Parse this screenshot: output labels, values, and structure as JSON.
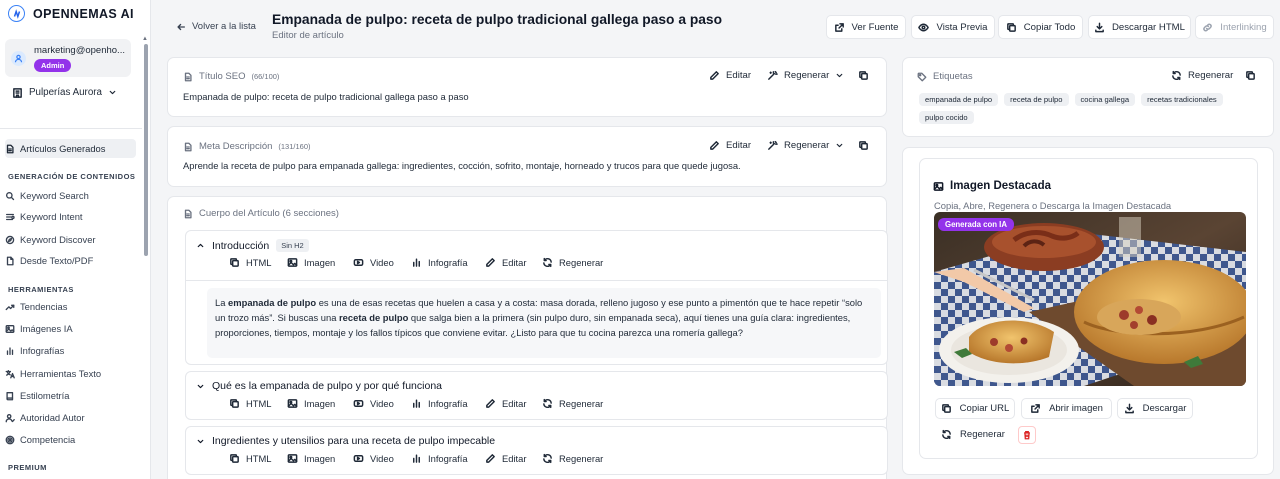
{
  "app": {
    "name": "OPENNEMAS AI"
  },
  "user": {
    "email": "marketing@openho...",
    "role_badge": "Admin"
  },
  "org": {
    "name": "Pulperías Aurora"
  },
  "sidebar": {
    "active_item": {
      "label": "Artículos Generados",
      "icon": "document-icon"
    },
    "groups": [
      {
        "heading": "GENERACIÓN DE CONTENIDOS",
        "items": [
          {
            "label": "Keyword Search",
            "icon": "search-icon"
          },
          {
            "label": "Keyword Intent",
            "icon": "target-icon"
          },
          {
            "label": "Keyword Discover",
            "icon": "compass-icon"
          },
          {
            "label": "Desde Texto/PDF",
            "icon": "file-icon"
          }
        ]
      },
      {
        "heading": "HERRAMIENTAS",
        "items": [
          {
            "label": "Tendencias",
            "icon": "trending-icon"
          },
          {
            "label": "Imágenes IA",
            "icon": "image-icon"
          },
          {
            "label": "Infografías",
            "icon": "bar-chart-icon"
          },
          {
            "label": "Herramientas Texto",
            "icon": "translate-icon"
          },
          {
            "label": "Estilometría",
            "icon": "book-icon"
          },
          {
            "label": "Autoridad Autor",
            "icon": "user-check-icon"
          },
          {
            "label": "Competencia",
            "icon": "radar-icon"
          }
        ]
      },
      {
        "heading": "PREMIUM",
        "items": []
      }
    ]
  },
  "header": {
    "back_label": "Volver a la lista",
    "title": "Empanada de pulpo: receta de pulpo tradicional gallega paso a paso",
    "subtitle": "Editor de artículo",
    "buttons": {
      "ver_fuente": "Ver Fuente",
      "vista_previa": "Vista Previa",
      "copiar_todo": "Copiar Todo",
      "descargar_html": "Descargar HTML",
      "interlinking": "Interlinking"
    }
  },
  "seo": {
    "label": "Título SEO",
    "count": "(66/100)",
    "value": "Empanada de pulpo: receta de pulpo tradicional gallega paso a paso",
    "edit_label": "Editar",
    "regen_label": "Regenerar"
  },
  "meta": {
    "label": "Meta Descripción",
    "count": "(131/160)",
    "value": "Aprende la receta de pulpo para empanada gallega: ingredientes, cocción, sofrito, montaje, horneado y trucos para que quede jugosa.",
    "edit_label": "Editar",
    "regen_label": "Regenerar"
  },
  "body": {
    "label": "Cuerpo del Artículo (6 secciones)",
    "action_labels": {
      "html": "HTML",
      "imagen": "Imagen",
      "video": "Video",
      "infografia": "Infografía",
      "editar": "Editar",
      "regenerar": "Regenerar"
    },
    "sections": [
      {
        "title": "Introducción",
        "badge": "Sin H2",
        "expanded": true,
        "paragraph": {
          "p1": "La ",
          "b1": "empanada de pulpo",
          "p2": " es una de esas recetas que huelen a casa y a costa: masa dorada, relleno jugoso y ese punto a pimentón que te hace repetir “solo un trozo más”. Si buscas una ",
          "b2": "receta de pulpo",
          "p3": " que salga bien a la primera (sin pulpo duro, sin empanada seca), aquí tienes una guía clara: ingredientes, proporciones, tiempos, montaje y los fallos típicos que conviene evitar. ¿Listo para que tu cocina parezca una romería gallega?"
        }
      },
      {
        "title": "Qué es la empanada de pulpo y por qué funciona",
        "expanded": false
      },
      {
        "title": "Ingredientes y utensilios para una receta de pulpo impecable",
        "expanded": false
      }
    ]
  },
  "tags": {
    "label": "Etiquetas",
    "regen_label": "Regenerar",
    "items": [
      "empanada de pulpo",
      "receta de pulpo",
      "cocina gallega",
      "recetas tradicionales",
      "pulpo cocido"
    ]
  },
  "featured_image": {
    "title": "Imagen Destacada",
    "subtitle": "Copia, Abre, Regenera o Descarga la Imagen Destacada",
    "badge": "Generada con IA",
    "buttons": {
      "copy_url": "Copiar URL",
      "open": "Abrir imagen",
      "download": "Descargar",
      "regen": "Regenerar"
    }
  }
}
